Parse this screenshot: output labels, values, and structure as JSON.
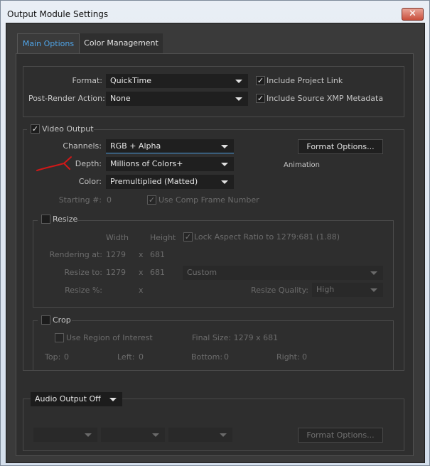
{
  "window": {
    "title": "Output Module Settings",
    "close_glyph": "✕"
  },
  "tabs": [
    {
      "label": "Main Options"
    },
    {
      "label": "Color Management"
    }
  ],
  "format": {
    "format_label": "Format:",
    "format_value": "QuickTime",
    "post_render_label": "Post-Render Action:",
    "post_render_value": "None",
    "include_project_link": {
      "label": "Include Project Link",
      "checked": true
    },
    "include_xmp": {
      "label": "Include Source XMP Metadata",
      "checked": true
    }
  },
  "video": {
    "label": "Video Output",
    "checked": true,
    "channels_label": "Channels:",
    "channels_value": "RGB + Alpha",
    "depth_label": "Depth:",
    "depth_value": "Millions of Colors+",
    "color_label": "Color:",
    "color_value": "Premultiplied (Matted)",
    "format_options": "Format Options...",
    "codec": "Animation",
    "starting_label": "Starting #:",
    "starting_value": "0",
    "use_comp_frame": "Use Comp Frame Number"
  },
  "resize": {
    "label": "Resize",
    "width_hdr": "Width",
    "height_hdr": "Height",
    "lock_aspect": "Lock Aspect Ratio to 1279:681 (1.88)",
    "rendering_label": "Rendering at:",
    "rendering_w": "1279",
    "rendering_x": "x",
    "rendering_h": "681",
    "resize_to_label": "Resize to:",
    "resize_to_w": "1279",
    "resize_to_x": "x",
    "resize_to_h": "681",
    "preset_value": "Custom",
    "resize_pct_label": "Resize %:",
    "resize_pct_x": "x",
    "quality_label": "Resize Quality:",
    "quality_value": "High"
  },
  "crop": {
    "label": "Crop",
    "use_roi": "Use Region of Interest",
    "final_size": "Final Size: 1279 x 681",
    "top_label": "Top:",
    "top_value": "0",
    "left_label": "Left:",
    "left_value": "0",
    "bottom_label": "Bottom:",
    "bottom_value": "0",
    "right_label": "Right:",
    "right_value": "0"
  },
  "audio": {
    "dropdown_value": "Audio Output Off",
    "format_options": "Format Options..."
  },
  "colors": {
    "accent": "#4fa3e6",
    "annotation": "#d01818",
    "panel": "#2e2e2e"
  }
}
